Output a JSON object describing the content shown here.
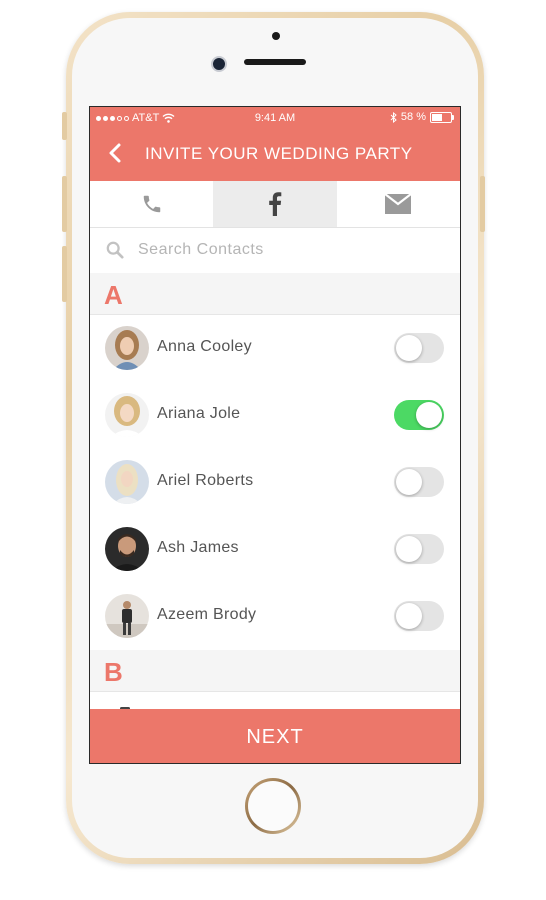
{
  "status_bar": {
    "carrier": "AT&T",
    "time": "9:41 AM",
    "battery": "58 %"
  },
  "header": {
    "title": "INVITE YOUR WEDDING PARTY"
  },
  "tabs": [
    {
      "icon": "phone-icon",
      "active": false
    },
    {
      "icon": "facebook-icon",
      "active": true
    },
    {
      "icon": "mail-icon",
      "active": false
    }
  ],
  "search": {
    "placeholder": "Search Contacts"
  },
  "sections": [
    {
      "letter": "A",
      "contacts": [
        {
          "name": "Anna Cooley",
          "selected": false
        },
        {
          "name": "Ariana Jole",
          "selected": true
        },
        {
          "name": "Ariel Roberts",
          "selected": false
        },
        {
          "name": "Ash James",
          "selected": false
        },
        {
          "name": "Azeem Brody",
          "selected": false
        }
      ]
    },
    {
      "letter": "B",
      "contacts": []
    }
  ],
  "footer": {
    "next_label": "NEXT"
  },
  "colors": {
    "accent": "#ec776a",
    "toggle_on": "#4cd964",
    "toggle_off": "#e4e4e4"
  }
}
